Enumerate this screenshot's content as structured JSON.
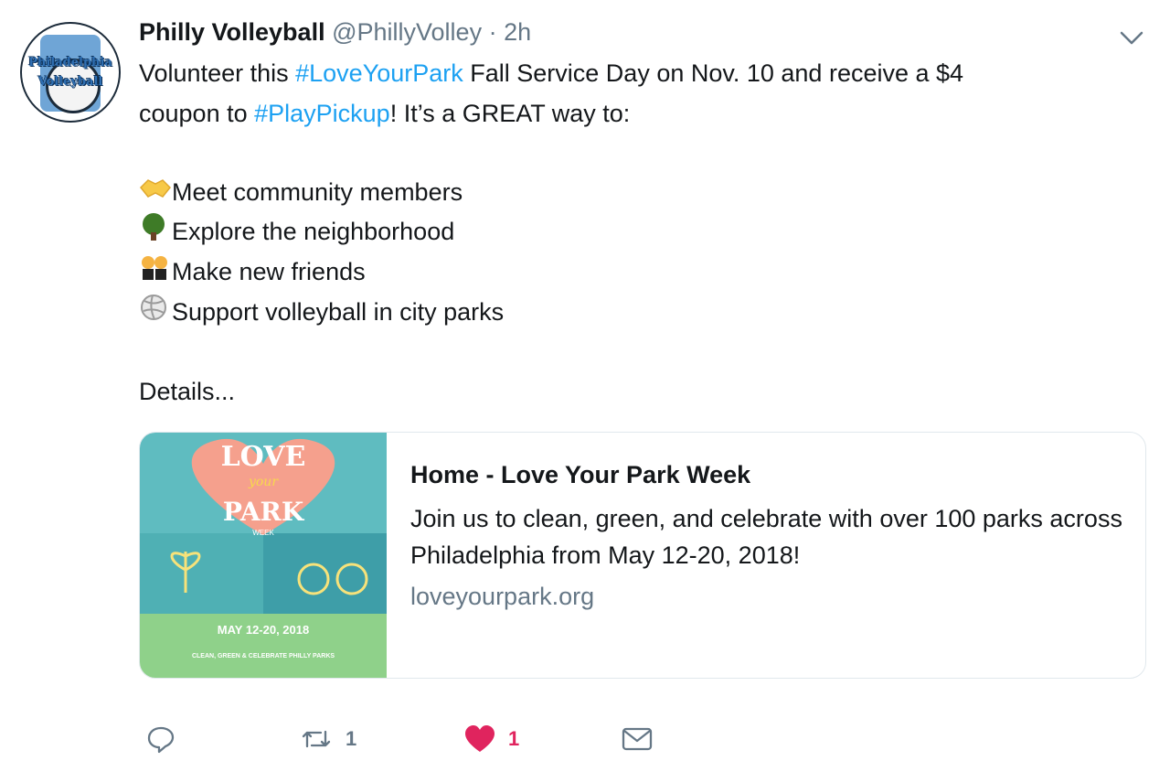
{
  "author": {
    "name": "Philly Volleyball",
    "handle": "@PhillyVolley",
    "time": "· 2h",
    "avatar_text_1": "Philadelphia",
    "avatar_text_2": "Volleyball"
  },
  "tweet": {
    "line1_pre": "Volunteer this ",
    "line1_hashtag": "#LoveYourPark",
    "line1_post": " Fall Service Day on Nov. 10 and receive a $4",
    "line2_pre": "coupon to ",
    "line2_hashtag": "#PlayPickup",
    "line2_post": "! It’s a GREAT way to:",
    "bullets": [
      {
        "icon": "handshake-icon",
        "text": "Meet community members"
      },
      {
        "icon": "tree-icon",
        "text": "Explore the neighborhood"
      },
      {
        "icon": "dancers-icon",
        "text": "Make new friends"
      },
      {
        "icon": "volleyball-icon",
        "text": "Support volleyball in city parks"
      }
    ],
    "details": "Details..."
  },
  "card": {
    "title": "Home - Love Your Park Week",
    "description": "Join us to clean, green, and celebrate with over 100 parks across Philadelphia from May 12-20, 2018!",
    "domain": "loveyourpark.org",
    "thumb": {
      "love": "LOVE",
      "your": "your",
      "park": "PARK",
      "week": "WEEK",
      "date": "MAY 12-20, 2018",
      "tagline": "CLEAN, GREEN & CELEBRATE PHILLY PARKS"
    }
  },
  "actions": {
    "reply_count": "",
    "retweet_count": "1",
    "like_count": "1"
  },
  "colors": {
    "link": "#1da1f2",
    "muted": "#657786",
    "like": "#e0245e",
    "thumb_teal": "#5fbcc0",
    "thumb_green": "#8fd18a",
    "thumb_peach": "#f5a08d"
  }
}
